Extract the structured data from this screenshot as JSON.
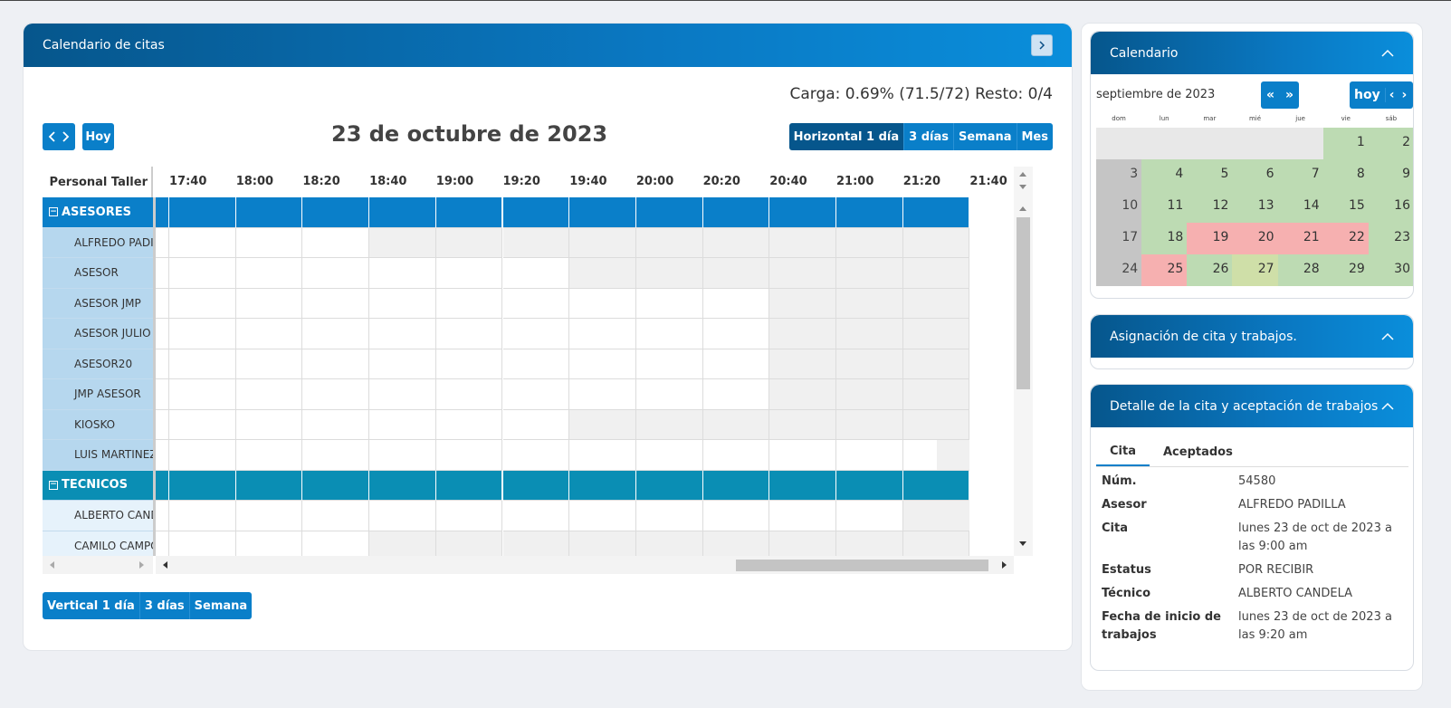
{
  "main": {
    "title": "Calendario de citas",
    "carga": "Carga: 0.69% (71.5/72) Resto: 0/4",
    "today_btn": "Hoy",
    "date_title": "23 de octubre de 2023",
    "views": [
      "Horizontal 1 día",
      "3 días",
      "Semana",
      "Mes"
    ],
    "bottom_views": [
      "Vertical 1 día",
      "3 días",
      "Semana"
    ],
    "scheduler": {
      "corner_label": "Personal Taller",
      "times": [
        "17:40",
        "18:00",
        "18:20",
        "18:40",
        "19:00",
        "19:20",
        "19:40",
        "20:00",
        "20:20",
        "20:40",
        "21:00",
        "21:20",
        "21:40"
      ],
      "groups": [
        {
          "name": "ASESORES",
          "toggle": "−",
          "members": [
            "ALFREDO PADILLA",
            "ASESOR",
            "ASESOR JMP",
            "ASESOR JULIO",
            "ASESOR20",
            "JMP ASESOR",
            "KIOSKO",
            "LUIS MARTINEZ"
          ]
        },
        {
          "name": "TECNICOS",
          "toggle": "−",
          "members": [
            "ALBERTO CANDELA",
            "CAMILO CAMPOS"
          ]
        }
      ]
    }
  },
  "calendar": {
    "title": "Calendario",
    "month": "septiembre de 2023",
    "today_btn": "hoy",
    "dow": [
      "dom",
      "lun",
      "mar",
      "mié",
      "jue",
      "vie",
      "sáb"
    ],
    "weeks": [
      [
        "",
        "",
        "",
        "",
        "",
        "1",
        "2"
      ],
      [
        "3",
        "4",
        "5",
        "6",
        "7",
        "8",
        "9"
      ],
      [
        "10",
        "11",
        "12",
        "13",
        "14",
        "15",
        "16"
      ],
      [
        "17",
        "18",
        "19",
        "20",
        "21",
        "22",
        "23"
      ],
      [
        "24",
        "25",
        "26",
        "27",
        "28",
        "29",
        "30"
      ]
    ]
  },
  "asignacion": {
    "title": "Asignación de cita y trabajos."
  },
  "detalle": {
    "title": "Detalle de la cita y aceptación de trabajos",
    "tabs": [
      "Cita",
      "Aceptados"
    ],
    "fields": {
      "num_label": "Núm.",
      "num": "54580",
      "asesor_label": "Asesor",
      "asesor": "ALFREDO PADILLA",
      "cita_label": "Cita",
      "cita": "lunes 23 de oct de 2023 a las 9:00 am",
      "estatus_label": "Estatus",
      "estatus": "POR RECIBIR",
      "tecnico_label": "Técnico",
      "tecnico": "ALBERTO CANDELA",
      "fecha_label": "Fecha de inicio de trabajos",
      "fecha": "lunes 23 de oct de 2023 a las 9:20 am"
    }
  }
}
